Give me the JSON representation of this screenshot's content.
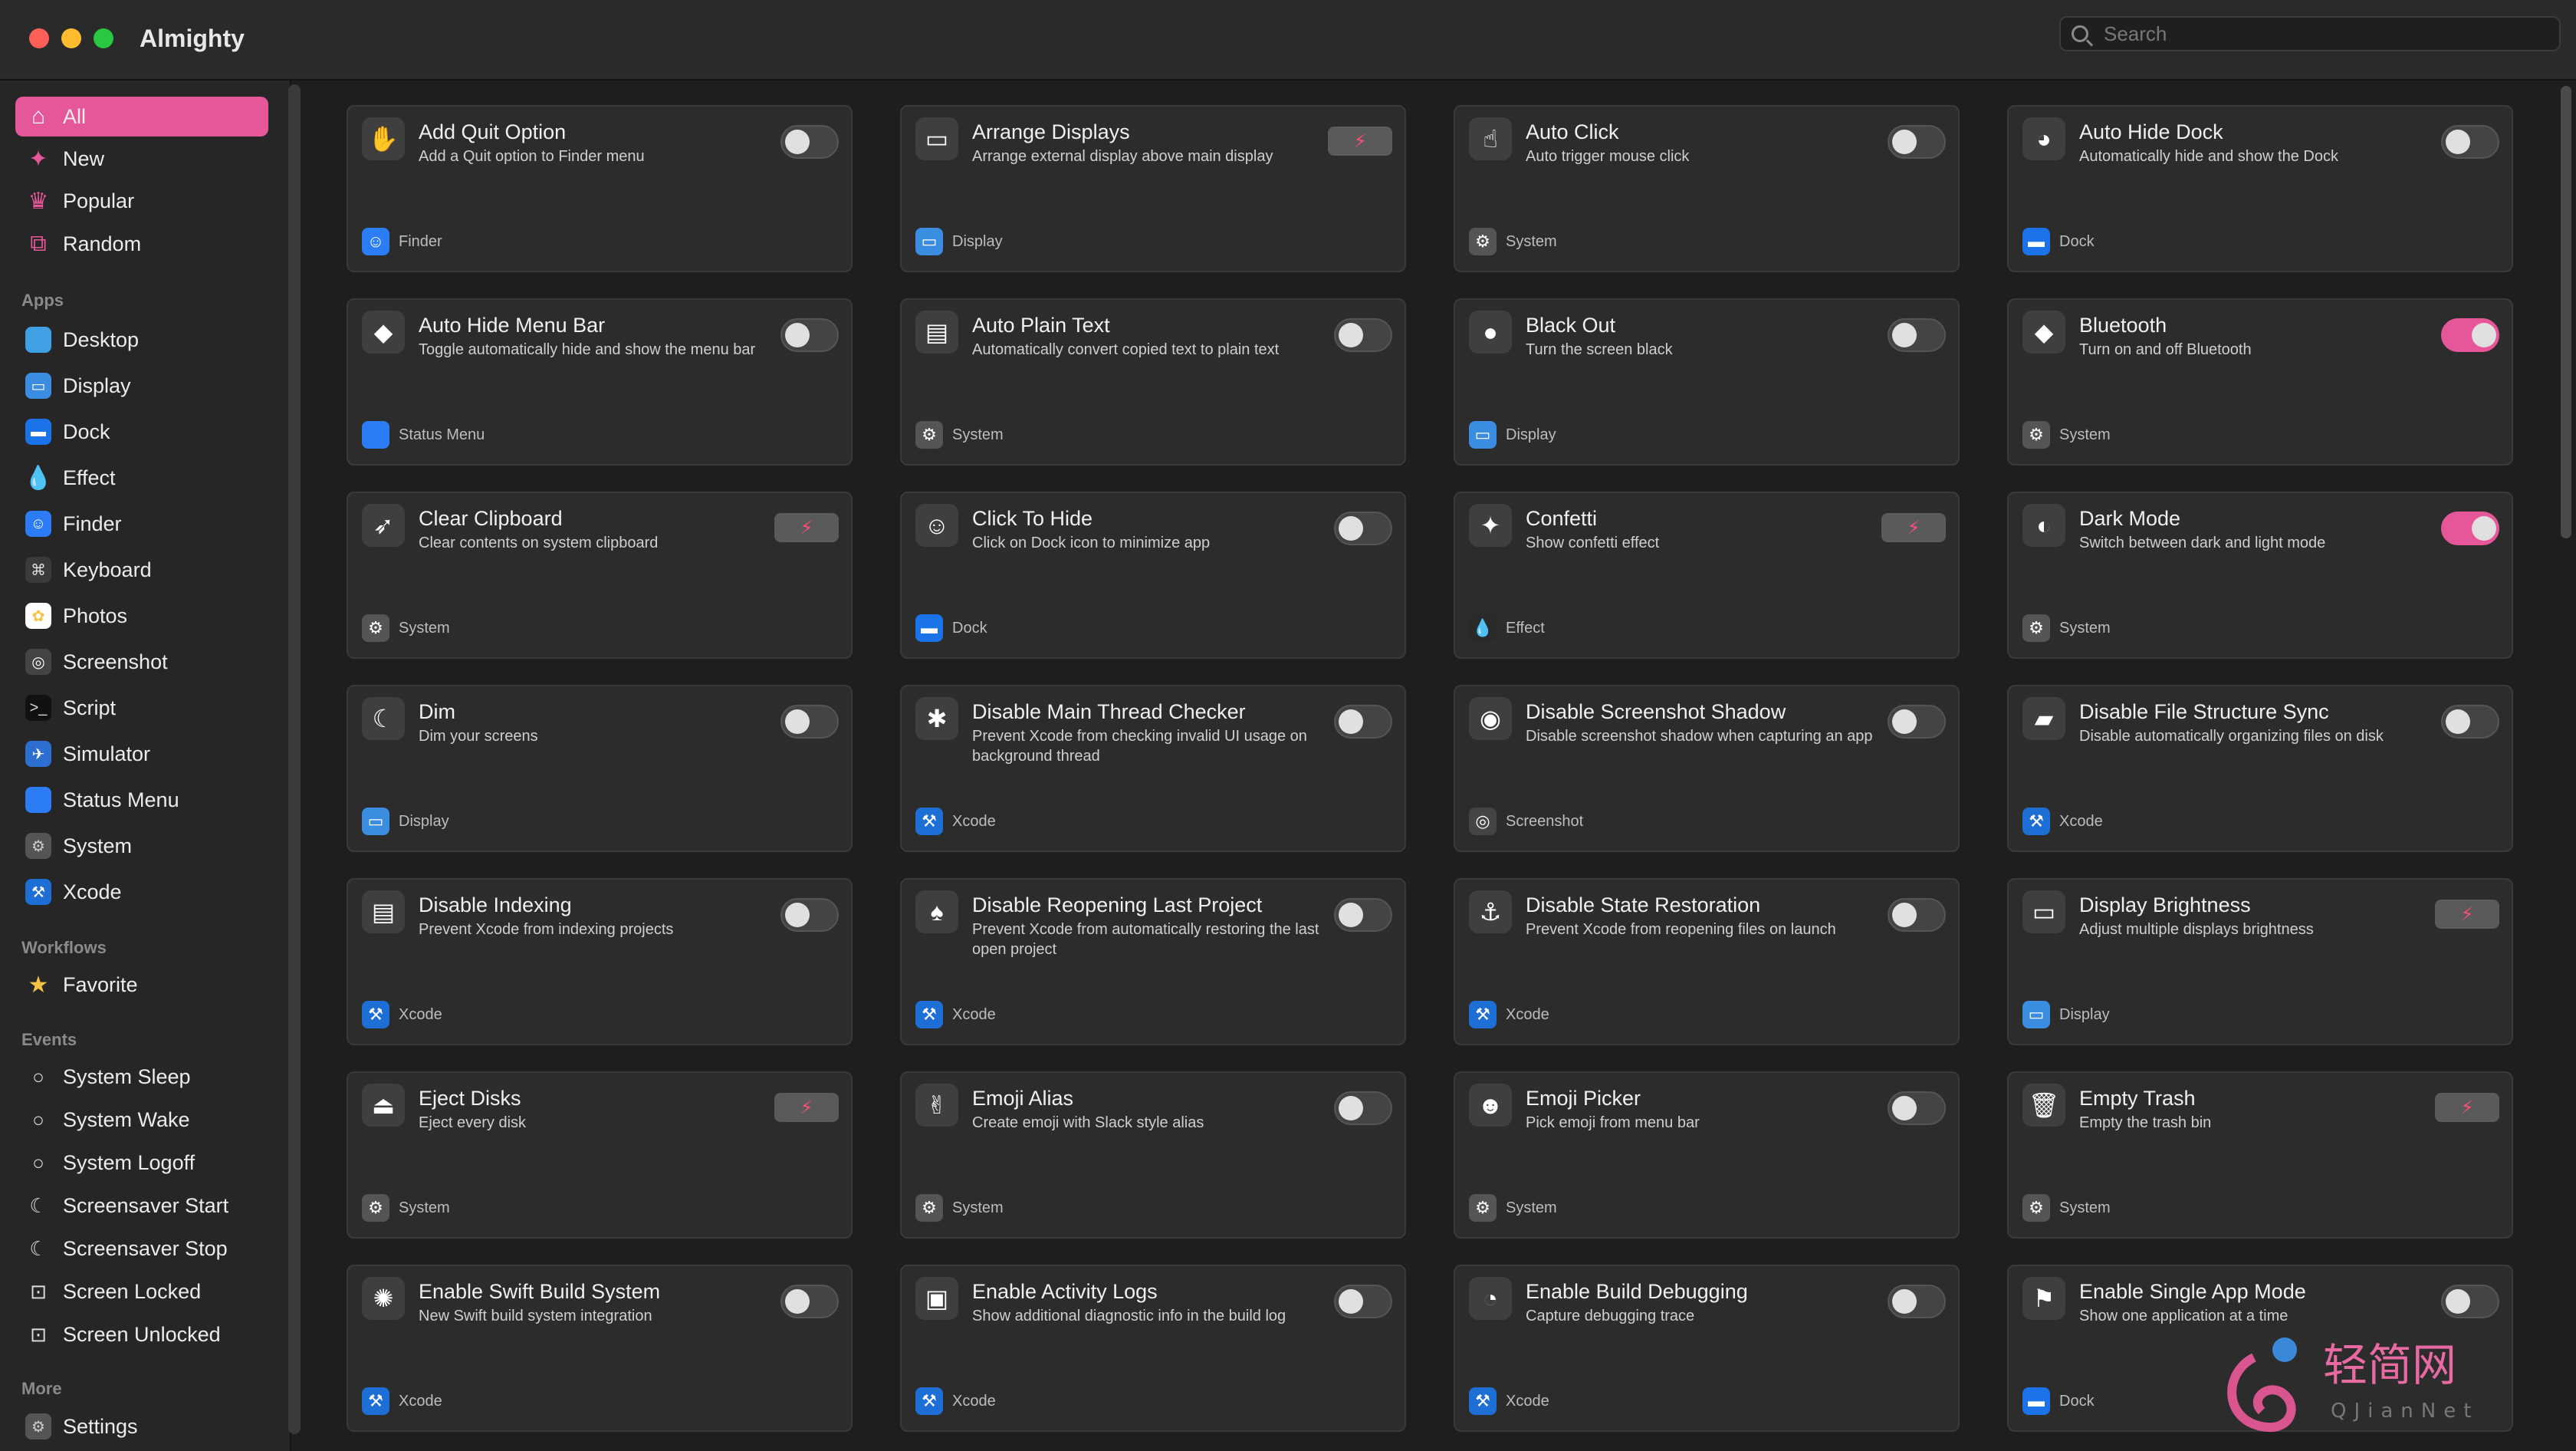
{
  "app": {
    "title": "Almighty"
  },
  "search": {
    "placeholder": "Search"
  },
  "sidebar": {
    "top": [
      {
        "label": "All",
        "icon": "house-icon",
        "active": true
      },
      {
        "label": "New",
        "icon": "sparkle-icon"
      },
      {
        "label": "Popular",
        "icon": "crown-icon"
      },
      {
        "label": "Random",
        "icon": "shuffle-icon"
      }
    ],
    "apps_heading": "Apps",
    "apps": [
      {
        "label": "Desktop",
        "icon": "desktop-icon"
      },
      {
        "label": "Display",
        "icon": "monitor-icon"
      },
      {
        "label": "Dock",
        "icon": "dock-icon"
      },
      {
        "label": "Effect",
        "icon": "drop-icon"
      },
      {
        "label": "Finder",
        "icon": "finder-icon"
      },
      {
        "label": "Keyboard",
        "icon": "command-icon"
      },
      {
        "label": "Photos",
        "icon": "photos-icon"
      },
      {
        "label": "Screenshot",
        "icon": "screenshot-icon"
      },
      {
        "label": "Script",
        "icon": "terminal-icon"
      },
      {
        "label": "Simulator",
        "icon": "simulator-icon"
      },
      {
        "label": "Status Menu",
        "icon": "apple-icon"
      },
      {
        "label": "System",
        "icon": "gear-icon"
      },
      {
        "label": "Xcode",
        "icon": "hammer-icon"
      }
    ],
    "workflows_heading": "Workflows",
    "workflows": [
      {
        "label": "Favorite",
        "icon": "star-icon"
      }
    ],
    "events_heading": "Events",
    "events": [
      {
        "label": "System Sleep",
        "icon": "circle-icon"
      },
      {
        "label": "System Wake",
        "icon": "circle-icon"
      },
      {
        "label": "System Logoff",
        "icon": "circle-icon"
      },
      {
        "label": "Screensaver Start",
        "icon": "moon-icon"
      },
      {
        "label": "Screensaver Stop",
        "icon": "moon-icon"
      },
      {
        "label": "Screen Locked",
        "icon": "screen-icon"
      },
      {
        "label": "Screen Unlocked",
        "icon": "screen-icon"
      }
    ],
    "more_heading": "More",
    "more": [
      {
        "label": "Settings",
        "icon": "gear-icon"
      }
    ]
  },
  "cards": [
    {
      "title": "Add Quit Option",
      "desc": "Add a Quit option to Finder menu",
      "category": "Finder",
      "control": "toggle",
      "on": false,
      "icon": "quit-icon",
      "glyph": "✋",
      "cat_glyph": "☺",
      "cat_color": "#2c7cf6"
    },
    {
      "title": "Arrange Displays",
      "desc": "Arrange external display above main display",
      "category": "Display",
      "control": "run",
      "icon": "monitor-icon",
      "glyph": "▭",
      "cat_glyph": "▭",
      "cat_color": "#3a8de0"
    },
    {
      "title": "Auto Click",
      "desc": "Auto trigger mouse click",
      "category": "System",
      "control": "toggle",
      "on": false,
      "icon": "pointer-icon",
      "glyph": "☝",
      "cat_glyph": "⚙",
      "cat_color": "#555"
    },
    {
      "title": "Auto Hide Dock",
      "desc": "Automatically hide and show the Dock",
      "category": "Dock",
      "control": "toggle",
      "on": false,
      "icon": "monkey-icon",
      "glyph": "◕",
      "cat_glyph": "▬",
      "cat_color": "#1a73e8"
    },
    {
      "title": "Auto Hide Menu Bar",
      "desc": "Toggle automatically hide and show the menu bar",
      "category": "Status Menu",
      "control": "toggle",
      "on": false,
      "icon": "eraser-icon",
      "glyph": "◆",
      "cat_glyph": "",
      "cat_color": "#2c7cf6"
    },
    {
      "title": "Auto Plain Text",
      "desc": "Automatically convert copied text to plain text",
      "category": "System",
      "control": "toggle",
      "on": false,
      "icon": "document-icon",
      "glyph": "▤",
      "cat_glyph": "⚙",
      "cat_color": "#555"
    },
    {
      "title": "Black Out",
      "desc": "Turn the screen black",
      "category": "Display",
      "control": "toggle",
      "on": false,
      "icon": "blackout-icon",
      "glyph": "●",
      "cat_glyph": "▭",
      "cat_color": "#3a8de0"
    },
    {
      "title": "Bluetooth",
      "desc": "Turn on and off Bluetooth",
      "category": "System",
      "control": "toggle",
      "on": true,
      "icon": "bluetooth-icon",
      "glyph": "◆",
      "cat_glyph": "⚙",
      "cat_color": "#555"
    },
    {
      "title": "Clear Clipboard",
      "desc": "Clear contents on system clipboard",
      "category": "System",
      "control": "run",
      "icon": "broom-icon",
      "glyph": "➶",
      "cat_glyph": "⚙",
      "cat_color": "#555"
    },
    {
      "title": "Click To Hide",
      "desc": "Click on Dock icon to minimize app",
      "category": "Dock",
      "control": "toggle",
      "on": false,
      "icon": "ghost-icon",
      "glyph": "☺",
      "cat_glyph": "▬",
      "cat_color": "#1a73e8"
    },
    {
      "title": "Confetti",
      "desc": "Show confetti effect",
      "category": "Effect",
      "control": "run",
      "icon": "confetti-icon",
      "glyph": "✦",
      "cat_glyph": "💧",
      "cat_color": "#2a2a2a"
    },
    {
      "title": "Dark Mode",
      "desc": "Switch between dark and light mode",
      "category": "System",
      "control": "toggle",
      "on": true,
      "icon": "halfmoon-icon",
      "glyph": "◐",
      "cat_glyph": "⚙",
      "cat_color": "#555"
    },
    {
      "title": "Dim",
      "desc": "Dim your screens",
      "category": "Display",
      "control": "toggle",
      "on": false,
      "icon": "moon-icon",
      "glyph": "☾",
      "cat_glyph": "▭",
      "cat_color": "#3a8de0"
    },
    {
      "title": "Disable Main Thread Checker",
      "desc": "Prevent Xcode from checking invalid UI usage on background thread",
      "category": "Xcode",
      "control": "toggle",
      "on": false,
      "icon": "rabbit-icon",
      "glyph": "✱",
      "cat_glyph": "⚒",
      "cat_color": "#1d6fd6"
    },
    {
      "title": "Disable Screenshot Shadow",
      "desc": "Disable screenshot shadow when capturing an app",
      "category": "Screenshot",
      "control": "toggle",
      "on": false,
      "icon": "camera-icon",
      "glyph": "◉",
      "cat_glyph": "◎",
      "cat_color": "#444"
    },
    {
      "title": "Disable File Structure Sync",
      "desc": "Disable automatically organizing files on disk",
      "category": "Xcode",
      "control": "toggle",
      "on": false,
      "icon": "folder-icon",
      "glyph": "▰",
      "cat_glyph": "⚒",
      "cat_color": "#1d6fd6"
    },
    {
      "title": "Disable Indexing",
      "desc": "Prevent Xcode from indexing projects",
      "category": "Xcode",
      "control": "toggle",
      "on": false,
      "icon": "index-icon",
      "glyph": "▤",
      "cat_glyph": "⚒",
      "cat_color": "#1d6fd6"
    },
    {
      "title": "Disable Reopening Last Project",
      "desc": "Prevent Xcode from automatically restoring the last open project",
      "category": "Xcode",
      "control": "toggle",
      "on": false,
      "icon": "mushroom-icon",
      "glyph": "♠",
      "cat_glyph": "⚒",
      "cat_color": "#1d6fd6"
    },
    {
      "title": "Disable State Restoration",
      "desc": "Prevent Xcode from reopening files on launch",
      "category": "Xcode",
      "control": "toggle",
      "on": false,
      "icon": "restore-icon",
      "glyph": "⚓",
      "cat_glyph": "⚒",
      "cat_color": "#1d6fd6"
    },
    {
      "title": "Display Brightness",
      "desc": "Adjust multiple displays brightness",
      "category": "Display",
      "control": "run",
      "icon": "monitor-icon",
      "glyph": "▭",
      "cat_glyph": "▭",
      "cat_color": "#3a8de0"
    },
    {
      "title": "Eject Disks",
      "desc": "Eject every disk",
      "category": "System",
      "control": "run",
      "icon": "eject-icon",
      "glyph": "⏏",
      "cat_glyph": "⚙",
      "cat_color": "#555"
    },
    {
      "title": "Emoji Alias",
      "desc": "Create emoji with Slack style alias",
      "category": "System",
      "control": "toggle",
      "on": false,
      "icon": "hand-icon",
      "glyph": "✌",
      "cat_glyph": "⚙",
      "cat_color": "#555"
    },
    {
      "title": "Emoji Picker",
      "desc": "Pick emoji from menu bar",
      "category": "System",
      "control": "toggle",
      "on": false,
      "icon": "emoji-icon",
      "glyph": "☻",
      "cat_glyph": "⚙",
      "cat_color": "#555"
    },
    {
      "title": "Empty Trash",
      "desc": "Empty the trash bin",
      "category": "System",
      "control": "run",
      "icon": "trash-icon",
      "glyph": "🗑",
      "cat_glyph": "⚙",
      "cat_color": "#555"
    },
    {
      "title": "Enable Swift Build System",
      "desc": "New Swift build system integration",
      "category": "Xcode",
      "control": "toggle",
      "on": false,
      "icon": "swift-icon",
      "glyph": "✺",
      "cat_glyph": "⚒",
      "cat_color": "#1d6fd6"
    },
    {
      "title": "Enable Activity Logs",
      "desc": "Show additional diagnostic info in the build log",
      "category": "Xcode",
      "control": "toggle",
      "on": false,
      "icon": "logs-icon",
      "glyph": "▣",
      "cat_glyph": "⚒",
      "cat_color": "#1d6fd6"
    },
    {
      "title": "Enable Build Debugging",
      "desc": "Capture debugging trace",
      "category": "Xcode",
      "control": "toggle",
      "on": false,
      "icon": "croissant-icon",
      "glyph": "◔",
      "cat_glyph": "⚒",
      "cat_color": "#1d6fd6"
    },
    {
      "title": "Enable Single App Mode",
      "desc": "Show one application at a time",
      "category": "Dock",
      "control": "toggle",
      "on": false,
      "icon": "flag-icon",
      "glyph": "⚑",
      "cat_glyph": "▬",
      "cat_color": "#1a73e8"
    }
  ],
  "theme": {
    "accent": "#e6579a",
    "run_icon_color": "#ff4d7a"
  },
  "watermark": {
    "text_cn": "轻简网",
    "text_en": "QJianNet"
  }
}
